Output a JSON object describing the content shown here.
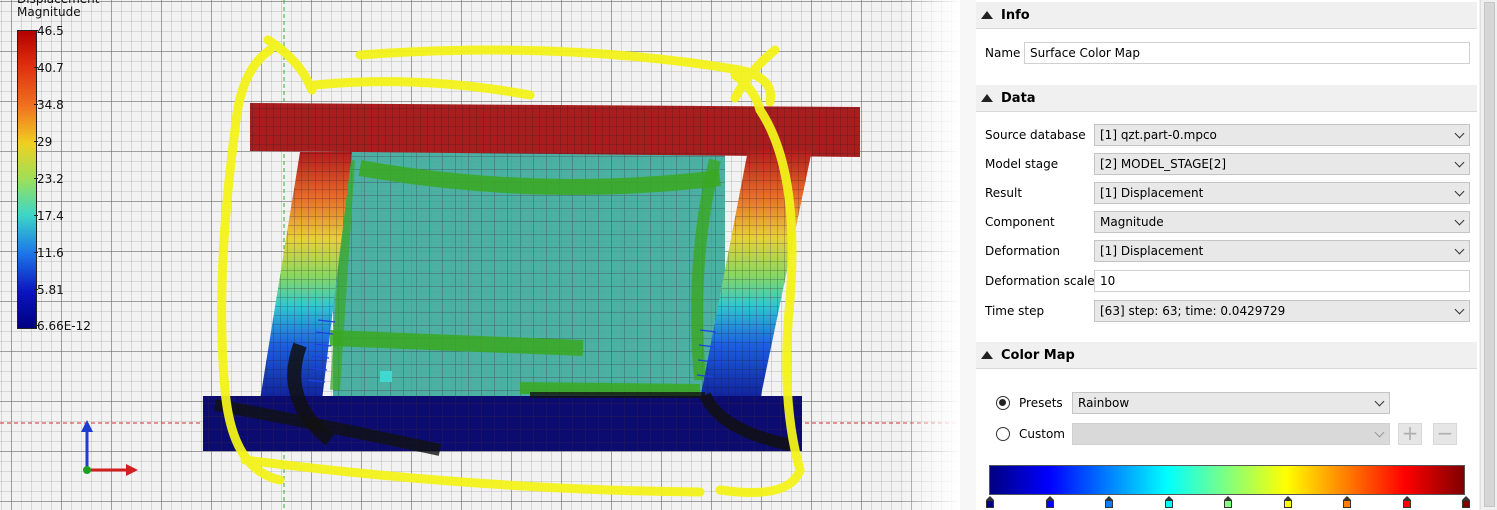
{
  "viewport": {
    "legend": {
      "title": "Displacement\nMagnitude",
      "ticks": [
        "46.5",
        "40.7",
        "34.8",
        "29",
        "23.2",
        "17.4",
        "11.6",
        "5.81",
        "6.66E-12"
      ]
    }
  },
  "panel": {
    "info": {
      "header": "Info",
      "name_label": "Name",
      "name_value": "Surface Color Map"
    },
    "data": {
      "header": "Data",
      "source_database_label": "Source database",
      "source_database_value": "[1] qzt.part-0.mpco",
      "model_stage_label": "Model stage",
      "model_stage_value": "[2] MODEL_STAGE[2]",
      "result_label": "Result",
      "result_value": "[1] Displacement",
      "component_label": "Component",
      "component_value": "Magnitude",
      "deformation_label": "Deformation",
      "deformation_value": "[1] Displacement",
      "deformation_scale_label": "Deformation scale",
      "deformation_scale_value": "10",
      "time_step_label": "Time step",
      "time_step_value": "[63] step: 63; time: 0.0429729"
    },
    "color_map": {
      "header": "Color Map",
      "presets_label": "Presets",
      "presets_value": "Rainbow",
      "custom_label": "Custom",
      "custom_value": "",
      "stop_colors": [
        "#000080",
        "#0000ff",
        "#0080ff",
        "#00ffff",
        "#80ff80",
        "#ffff00",
        "#ff8000",
        "#ff0000",
        "#800000"
      ]
    }
  }
}
